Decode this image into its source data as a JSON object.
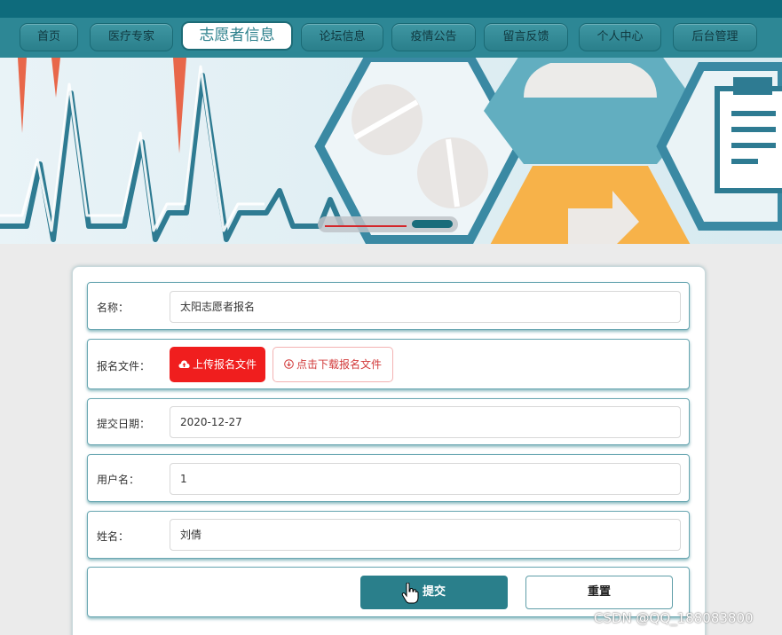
{
  "nav": {
    "items": [
      {
        "label": "首页",
        "active": false
      },
      {
        "label": "医疗专家",
        "active": false
      },
      {
        "label": "志愿者信息",
        "active": true
      },
      {
        "label": "论坛信息",
        "active": false
      },
      {
        "label": "疫情公告",
        "active": false
      },
      {
        "label": "留言反馈",
        "active": false
      },
      {
        "label": "个人中心",
        "active": false
      },
      {
        "label": "后台管理",
        "active": false
      }
    ]
  },
  "form": {
    "name_label": "名称：",
    "name_value": "太阳志愿者报名",
    "file_label": "报名文件：",
    "upload_label": "上传报名文件",
    "download_label": "点击下载报名文件",
    "date_label": "提交日期：",
    "date_value": "2020-12-27",
    "username_label": "用户名：",
    "username_value": "1",
    "realname_label": "姓名：",
    "realname_value": "刘倩",
    "submit_label": "提交",
    "reset_label": "重置"
  },
  "watermark": "CSDN @QQ_188083800",
  "colors": {
    "primary": "#2a7f8b",
    "nav_bg": "#2d8795",
    "upload_red": "#f01e1e",
    "carousel_active": "#1a6c7a"
  }
}
